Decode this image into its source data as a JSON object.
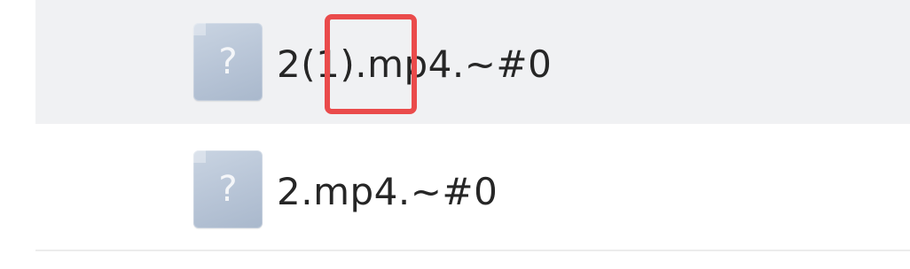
{
  "files": [
    {
      "name": "2(1).mp4.~#0",
      "icon": "unknown-file-icon",
      "glyph": "?",
      "selected": true
    },
    {
      "name": "2.mp4.~#0",
      "icon": "unknown-file-icon",
      "glyph": "?",
      "selected": false
    }
  ],
  "colors": {
    "selected_row": "#f0f1f3",
    "annotation": "#ea4b4b",
    "icon_fill": "#b7c4d6",
    "text": "#262626"
  }
}
